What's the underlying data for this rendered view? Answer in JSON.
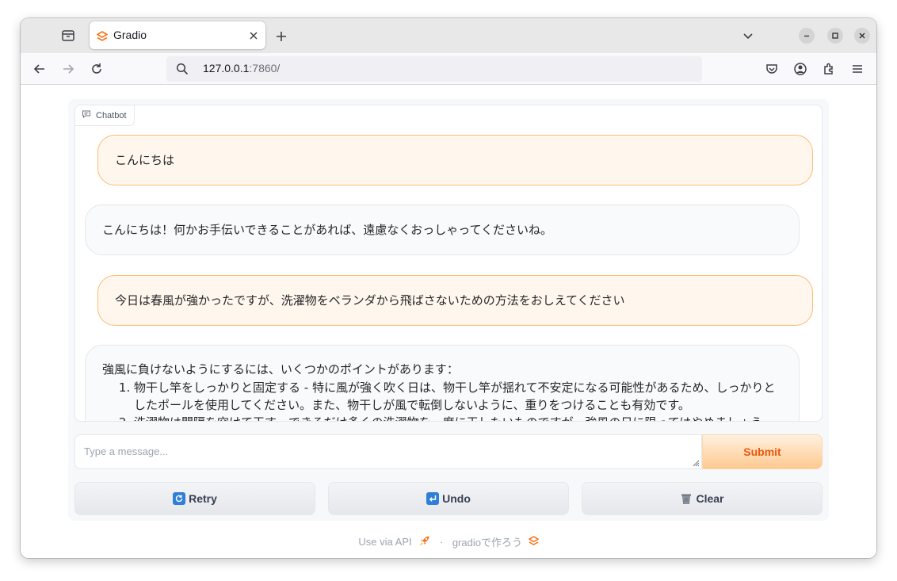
{
  "browser": {
    "tab_title": "Gradio",
    "url_host": "127.0.0.1",
    "url_port": ":7860/"
  },
  "chatbot": {
    "label": "Chatbot",
    "messages": [
      {
        "role": "user",
        "text": "こんにちは"
      },
      {
        "role": "bot",
        "text": "こんにちは！何かお手伝いできることがあれば、遠慮なくおっしゃってくださいね。"
      },
      {
        "role": "user",
        "text": "今日は春風が強かったですが、洗濯物をベランダから飛ばさないための方法をおしえてください"
      },
      {
        "role": "bot",
        "intro": "強風に負けないようにするには、いくつかのポイントがあります：",
        "items": [
          "物干し竿をしっかりと固定する - 特に風が強く吹く日は、物干し竿が揺れて不安定になる可能性があるため、しっかりとしたポールを使用してください。また、物干しが風で転倒しないように、重りをつけることも有効です。",
          "洗濯物は間隔を空けて干す - できるだけ多くの洗濯物を一度に干したいものですが、強風の日に限ってはやめましょう。"
        ]
      }
    ]
  },
  "input": {
    "placeholder": "Type a message...",
    "submit_label": "Submit"
  },
  "buttons": {
    "retry": "Retry",
    "undo": "Undo",
    "clear": "Clear"
  },
  "footer": {
    "api_link": "Use via API",
    "separator": "·",
    "built_with": "gradioで作ろう"
  },
  "colors": {
    "accent": "#ea580c",
    "user_bubble": "#fff7ed",
    "user_border": "#fdba74"
  }
}
